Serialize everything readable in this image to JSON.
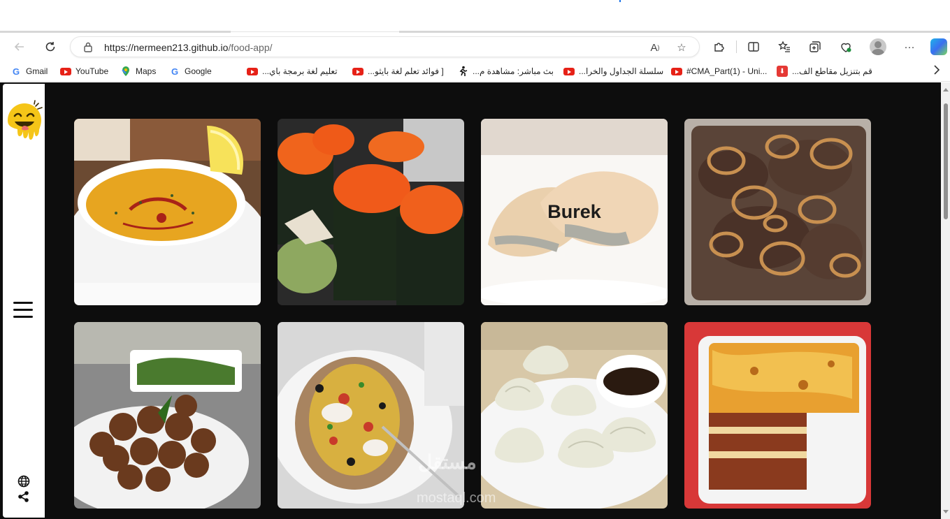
{
  "browser": {
    "url_host": "https://nermeen213.github.io",
    "url_path": "/food-app/",
    "bookmarks": [
      {
        "label": "Gmail",
        "icon": "google-icon"
      },
      {
        "label": "YouTube",
        "icon": "youtube-icon"
      },
      {
        "label": "Maps",
        "icon": "maps-icon"
      },
      {
        "label": "Google",
        "icon": "google-icon"
      },
      {
        "label": "",
        "icon": "microsoft-icon"
      },
      {
        "label": "تعليم لغة برمجة باي...",
        "icon": "youtube-icon"
      },
      {
        "label": "[ فوائد تعلم لغة بايثو...",
        "icon": "youtube-icon"
      },
      {
        "label": "بث مباشر: مشاهدة م...",
        "icon": "runner-icon"
      },
      {
        "label": "سلسلة الجداول والخرا...",
        "icon": "youtube-icon"
      },
      {
        "label": "#CMA_Part(1) - Uni...",
        "icon": "youtube-icon"
      },
      {
        "label": "قم بتنزيل مقاطع الف...",
        "icon": "download-icon"
      }
    ]
  },
  "app": {
    "hover_caption": "Burek",
    "watermark": "مستقل",
    "watermark_site": "mostaql.com"
  },
  "colors": {
    "page_background": "#0d0d0d",
    "sidebar": "#ffffff",
    "logo_yellow": "#f5c518"
  }
}
